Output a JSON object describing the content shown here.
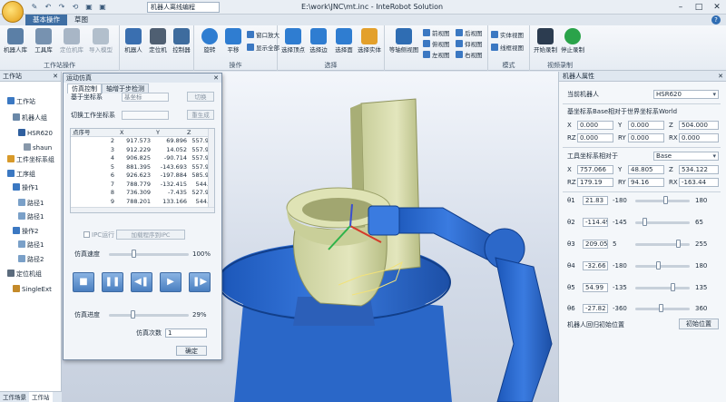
{
  "window": {
    "title": "E:\\work\\JNC\\mt.inc - InteRobot Solution",
    "doc_combo": "机器人离线编程"
  },
  "quick_access": [
    "✎",
    "↶",
    "↷",
    "⟲",
    "▣",
    "▣"
  ],
  "ribbon_tabs": [
    "基本操作",
    "草图"
  ],
  "ribbon": {
    "groups": {
      "workstation": "工作站操作",
      "operation": "操作",
      "select": "选择",
      "mode": "模式",
      "video": "视频录制"
    },
    "buttons": {
      "robot_lib": "机器人库",
      "tool_lib": "工具库",
      "part_lib": "定位机库",
      "import_model": "导入模型",
      "robot": "机器人",
      "positioner": "定位机",
      "controller": "控制器",
      "rotate": "旋转",
      "pan": "平移",
      "zoom_window": "窗口放大",
      "show_all": "显示全部",
      "sel_vertex": "选择顶点",
      "sel_edge": "选择边",
      "sel_face": "选择面",
      "sel_entity": "选择实体",
      "iso_view": "等轴侧视图",
      "front": "前视图",
      "back": "后视图",
      "top": "俯视图",
      "bottom": "仰视图",
      "left": "左视图",
      "right": "右视图",
      "solid": "实体视图",
      "wire": "线框视图",
      "start_rec": "开始录制",
      "stop_rec": "停止录制"
    }
  },
  "left_pane": {
    "title": "工作站",
    "tree": [
      {
        "label": "工作站",
        "icon": "workstation-icon"
      },
      {
        "label": "机器人组",
        "icon": "group-icon"
      },
      {
        "label": "HSR620",
        "icon": "robot-icon"
      },
      {
        "label": "shaun",
        "icon": "tool-icon"
      },
      {
        "label": "工件坐标系组",
        "icon": "frame-icon"
      },
      {
        "label": "工序组",
        "icon": "folder-icon"
      },
      {
        "label": "操作1",
        "icon": "op-icon"
      },
      {
        "label": "路径1",
        "icon": "path-icon"
      },
      {
        "label": "路径1",
        "icon": "path-icon"
      },
      {
        "label": "操作2",
        "icon": "op-icon"
      },
      {
        "label": "路径1",
        "icon": "path-icon"
      },
      {
        "label": "路径2",
        "icon": "path-icon"
      },
      {
        "label": "定位机组",
        "icon": "positioner-icon"
      },
      {
        "label": "SingleExt",
        "icon": "ext-icon"
      }
    ],
    "tabs": [
      "工作场景",
      "工作站"
    ]
  },
  "sim_dialog": {
    "title": "运动仿真",
    "tabs": [
      "仿真控制",
      "轴增于步检测"
    ],
    "base_frame_label": "基于坐标系",
    "base_frame_value": "基坐标",
    "switch_frame_label": "切换工作坐标系",
    "switch_frame_value": "",
    "switch_btn": "切换",
    "regen_btn": "重生成",
    "table": {
      "headers": [
        "点序号",
        "X",
        "Y",
        "Z"
      ],
      "rows": [
        [
          "2",
          "917.573",
          "69.896",
          "557.9"
        ],
        [
          "3",
          "912.229",
          "14.052",
          "557.9"
        ],
        [
          "4",
          "906.825",
          "-90.714",
          "557.9"
        ],
        [
          "5",
          "881.395",
          "-143.693",
          "557.9"
        ],
        [
          "6",
          "926.623",
          "-197.884",
          "585.9"
        ],
        [
          "7",
          "788.779",
          "-132.415",
          "544."
        ],
        [
          "8",
          "736.309",
          "-7.435",
          "527.9"
        ],
        [
          "9",
          "788.201",
          "133.166",
          "544."
        ],
        [
          "10",
          "",
          "",
          ""
        ]
      ]
    },
    "io_check_label": "IPC运行",
    "io_btn": "加载程序到IPC",
    "speed_label": "仿真速度",
    "speed_value_text": "100%",
    "speed_fraction": 0.3,
    "controls": [
      "■",
      "❚❚",
      "◀❚",
      "▶",
      "❚▶"
    ],
    "precision_label": "仿真进度",
    "precision_value_text": "29%",
    "precision_fraction": 0.29,
    "count_label": "仿真次数",
    "count_value": "1",
    "ok_btn": "确定"
  },
  "right_pane": {
    "title": "机器人属性",
    "current_robot_label": "当前机器人",
    "current_robot_value": "HSR620",
    "base_section": "基坐标系Base相对于世界坐标系World",
    "base": {
      "X": "0.000",
      "Y": "0.000",
      "Z": "504.000",
      "RZ": "0.000",
      "RY": "0.000",
      "RX": "0.000"
    },
    "tool_section_label": "工具坐标系相对于",
    "tool_section_value": "Base",
    "tool": {
      "X": "757.066",
      "Y": "48.805",
      "Z": "534.122",
      "RZ": "179.19",
      "RY": "94.16",
      "RX": "-163.44"
    },
    "joints": [
      {
        "name": "θ1",
        "value": "21.83",
        "min": "-180",
        "max": "180",
        "fraction": 0.56
      },
      {
        "name": "θ2",
        "value": "-114.49",
        "min": "-145",
        "max": "65",
        "fraction": 0.14
      },
      {
        "name": "θ3",
        "value": "209.05",
        "min": "5",
        "max": "255",
        "fraction": 0.82
      },
      {
        "name": "θ4",
        "value": "-32.66",
        "min": "-180",
        "max": "180",
        "fraction": 0.41
      },
      {
        "name": "θ5",
        "value": "54.99",
        "min": "-135",
        "max": "135",
        "fraction": 0.7
      },
      {
        "name": "θ6",
        "value": "-27.82",
        "min": "-360",
        "max": "360",
        "fraction": 0.48
      }
    ],
    "home_label": "机器人回归初始位置",
    "home_btn": "初始位置"
  }
}
